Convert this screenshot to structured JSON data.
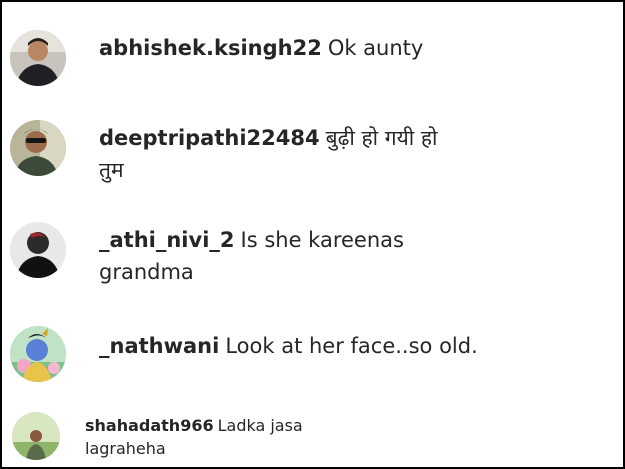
{
  "comments": [
    {
      "username": "abhishek.ksingh22",
      "text": "Ok aunty",
      "avatar_icon": "profile-photo-man-dark-shirt"
    },
    {
      "username": "deeptripathi22484",
      "text": "बुढ़ी हो गयी हो तुम",
      "avatar_icon": "profile-photo-man-sunglasses"
    },
    {
      "username": "_athi_nivi_2",
      "text": "Is she kareenas grandma",
      "avatar_icon": "profile-photo-silhouette-red"
    },
    {
      "username": "_nathwani",
      "text": "Look at her face..so old.",
      "avatar_icon": "profile-photo-cartoon-krishna"
    },
    {
      "username": "shahadath966",
      "text": "Ladka jasa lagraheha",
      "avatar_icon": "profile-photo-man-outdoors"
    }
  ]
}
